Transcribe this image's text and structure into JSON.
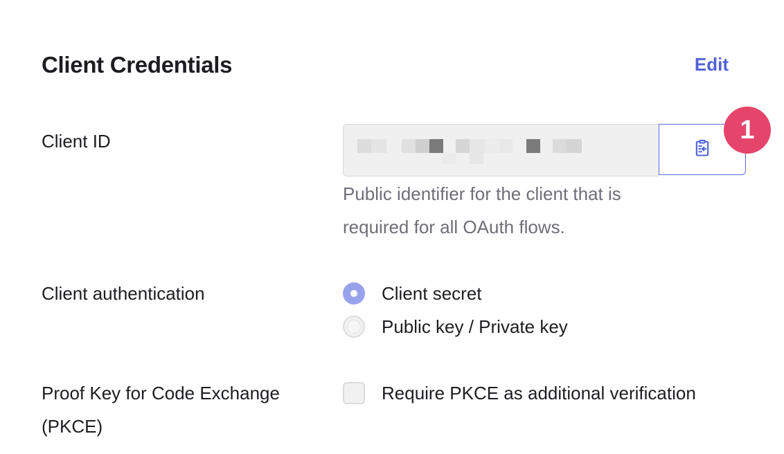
{
  "section": {
    "title": "Client Credentials",
    "edit_label": "Edit",
    "accent_color": "#4f62d8"
  },
  "client_id": {
    "label": "Client ID",
    "value_obscured": true,
    "copy_icon": "clipboard-copy-icon",
    "help_text": "Public identifier for the client that is required for all OAuth flows."
  },
  "badge": {
    "number": "1",
    "color": "#e6456b"
  },
  "client_auth": {
    "label": "Client authentication",
    "options": [
      {
        "label": "Client secret",
        "selected": true
      },
      {
        "label": "Public key / Private key",
        "selected": false
      }
    ]
  },
  "pkce": {
    "label": "Proof Key for Code Exchange (PKCE)",
    "checkbox_label": "Require PKCE as additional verification",
    "checked": false
  }
}
